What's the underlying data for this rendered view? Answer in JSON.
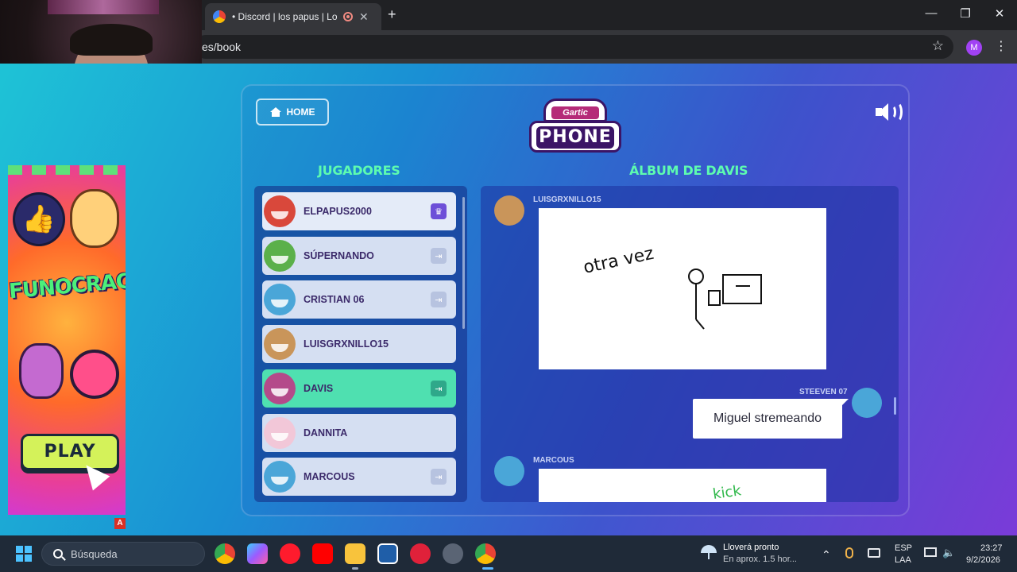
{
  "browser": {
    "tab_title": "• Discord | los papus | Los p",
    "tab_close": "✕",
    "new_tab": "+",
    "url": "es/book",
    "star": "☆",
    "profile_initial": "M",
    "menu": "⋮",
    "window_controls": {
      "minimize": "—",
      "restore": "❐",
      "close": "✕"
    }
  },
  "ad": {
    "logo_text": "FUNOCRACY",
    "play_label": "PLAY",
    "badge": "A"
  },
  "game": {
    "home_label": "HOME",
    "logo_small": "Gartic",
    "logo_big": "PHONE",
    "players_heading": "JUGADORES",
    "album_heading": "ÁLBUM DE DAVIS",
    "players": [
      {
        "name": "ELPAPUS2000",
        "color": "#d9483b",
        "icon": "crown-icon"
      },
      {
        "name": "SÚPERNANDO",
        "color": "#5bb04a",
        "icon": "exit-icon"
      },
      {
        "name": "CRISTIAN 06",
        "color": "#4aa6d8",
        "icon": "exit-icon"
      },
      {
        "name": "LUISGRXNILLO15",
        "color": "#c9955a",
        "icon": ""
      },
      {
        "name": "DAVIS",
        "color": "#b44a8a",
        "icon": "exit-icon"
      },
      {
        "name": "DANNITA",
        "color": "#f2c7d8",
        "icon": ""
      },
      {
        "name": "MARCOUS",
        "color": "#4aa6d8",
        "icon": "exit-icon"
      }
    ],
    "album": {
      "entry1_author": "LUISGRXNILLO15",
      "drawing1_text": "otra vez",
      "entry2_author": "STEEVEN 07",
      "entry2_text": "Miguel stremeando",
      "entry3_author": "MARCOUS",
      "drawing3_text": "kick"
    }
  },
  "taskbar": {
    "search_placeholder": "Búsqueda",
    "weather_line1": "Lloverá pronto",
    "weather_line2": "En aprox. 1.5 hor...",
    "lang_top": "ESP",
    "lang_bottom": "LAA",
    "time": "23:27",
    "date": "9/2/2026",
    "chevron": "⌃"
  }
}
